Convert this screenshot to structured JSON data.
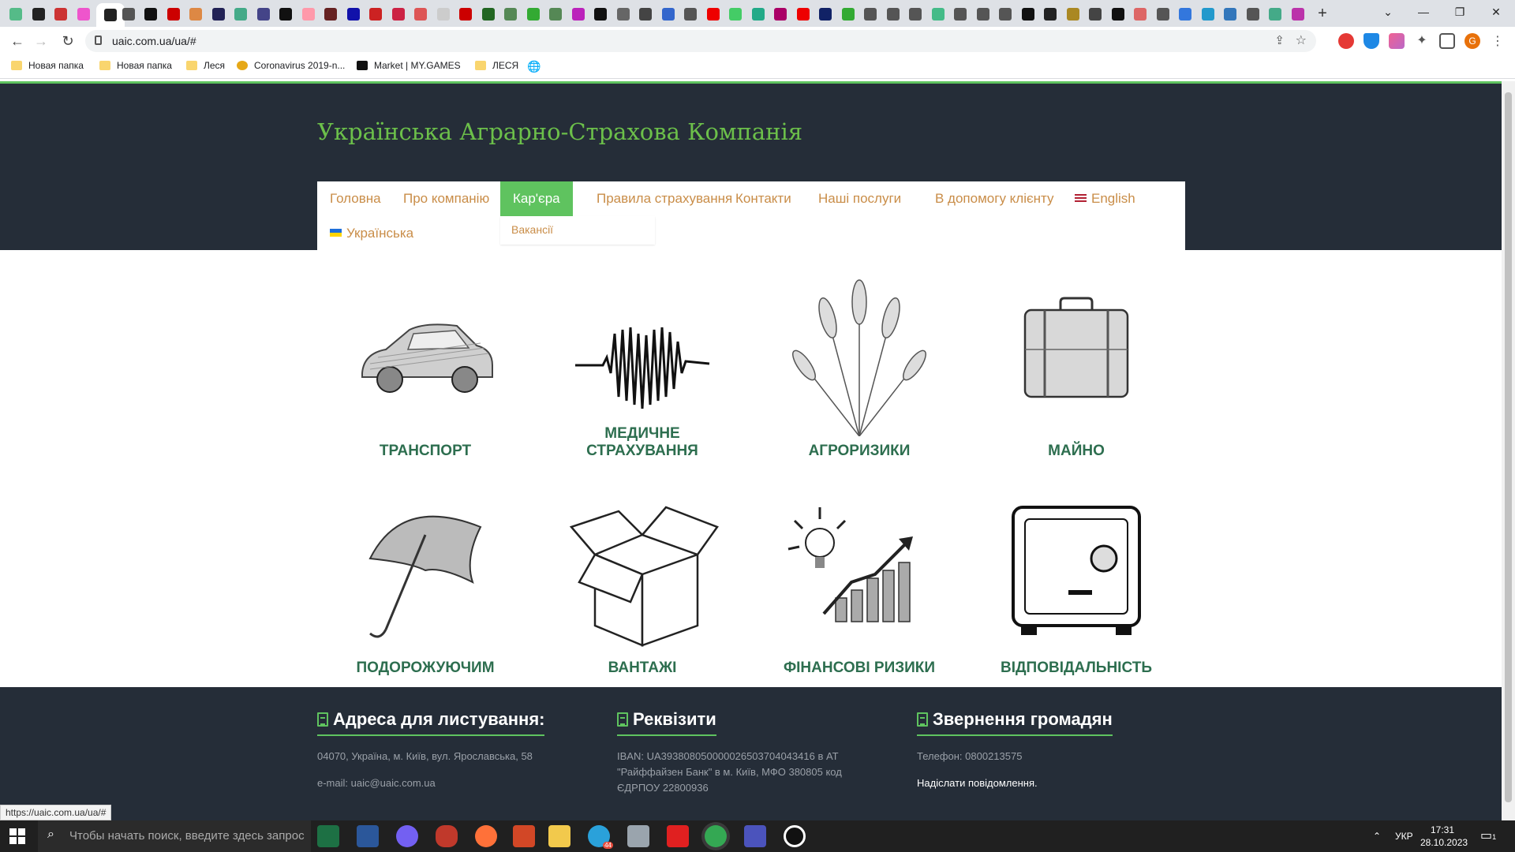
{
  "browser": {
    "url": "uaic.com.ua/ua/#",
    "status_url": "https://uaic.com.ua/ua/#",
    "new_tab": "+",
    "bookmarks": [
      {
        "label": "Новая папка",
        "icon": "folder-icon"
      },
      {
        "label": "Новая папка",
        "icon": "folder-icon"
      },
      {
        "label": "Леся",
        "icon": "folder-icon"
      },
      {
        "label": "Coronavirus 2019-n...",
        "icon": "coronavirus-icon"
      },
      {
        "label": "Market | MY.GAMES",
        "icon": "mygames-icon"
      },
      {
        "label": "ЛЕСЯ",
        "icon": "folder-icon"
      },
      {
        "label": "",
        "icon": "globe-icon"
      }
    ]
  },
  "site": {
    "title": "Українська Аграрно-Страхова Компанія",
    "menu": [
      {
        "label": "Головна"
      },
      {
        "label": "Про компанію"
      },
      {
        "label": "Кар'єра"
      },
      {
        "label": "Правила страхування"
      },
      {
        "label": "Контакти"
      },
      {
        "label": "Наші послуги"
      },
      {
        "label": "В допомогу клієнту"
      },
      {
        "label": "English"
      },
      {
        "label": "Українська"
      }
    ],
    "submenu": {
      "item": "Вакансії"
    },
    "tiles": [
      {
        "label": "ТРАНСПОРТ",
        "icon": "car-icon"
      },
      {
        "label": "МЕДИЧНЕ СТРАХУВАННЯ",
        "icon": "heartbeat-icon"
      },
      {
        "label": "АГРОРИЗИКИ",
        "icon": "wheat-icon"
      },
      {
        "label": "МАЙНО",
        "icon": "suitcase-icon"
      },
      {
        "label": "ПОДОРОЖУЮЧИМ",
        "icon": "umbrella-icon"
      },
      {
        "label": "ВАНТАЖІ",
        "icon": "box-icon"
      },
      {
        "label": "ФІНАНСОВІ РИЗИКИ",
        "icon": "growth-chart-icon"
      },
      {
        "label": "ВІДПОВІДАЛЬНІСТЬ",
        "icon": "safe-icon"
      }
    ]
  },
  "footer": {
    "address": {
      "title": "Адреса для листування:",
      "line1": "04070, Україна, м. Київ, вул. Ярославська, 58",
      "line2": "e-mail: uaic@uaic.com.ua"
    },
    "requisites": {
      "title": "Реквізити",
      "text": "IBAN: UA393808050000026503704043416 в АТ \"Райффайзен Банк\" в м. Київ, МФО 380805 код ЄДРПОУ 22800936"
    },
    "appeals": {
      "title": "Звернення громадян",
      "phone": "Телефон: 0800213575",
      "send": "Надіслати повідомлення."
    }
  },
  "taskbar": {
    "search_placeholder": "Чтобы начать поиск, введите здесь запрос",
    "lang": "УКР",
    "time": "17:31",
    "date": "28.10.2023",
    "telegram_badge": "44",
    "notif_count": "1"
  },
  "colors": {
    "brand_green": "#6cc04a",
    "header_bg": "#252d38",
    "menu_text": "#c98d48",
    "tile_text": "#2d6e4f"
  }
}
